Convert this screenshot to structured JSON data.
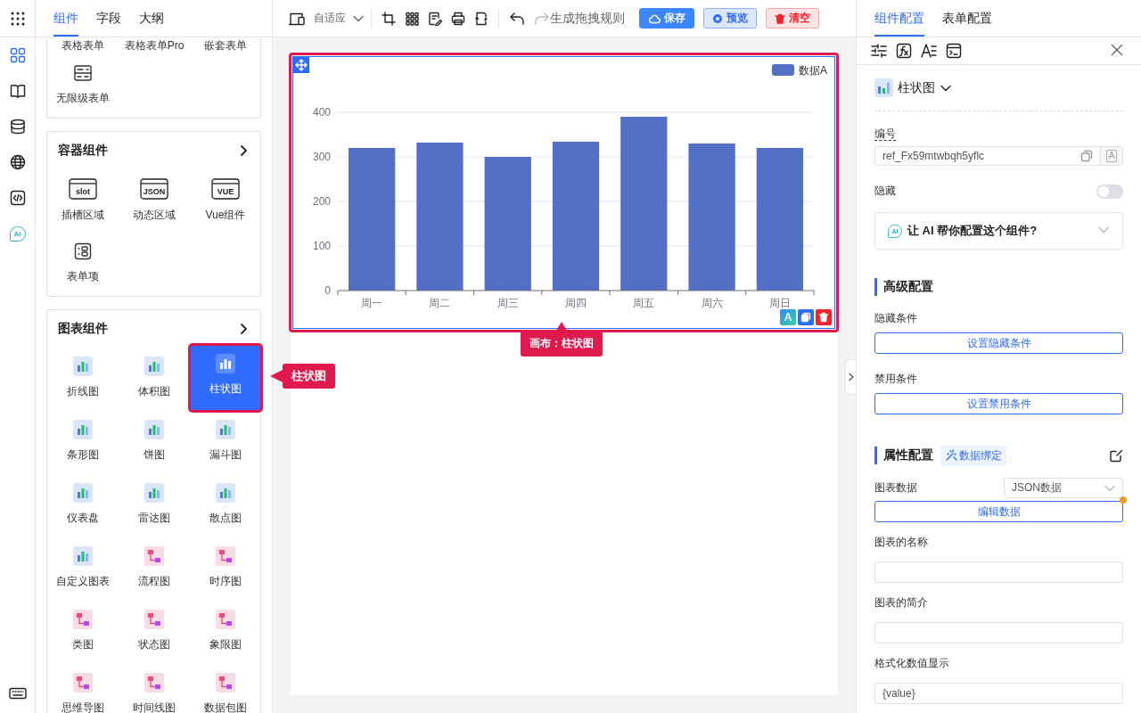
{
  "rail": {
    "items": [
      {
        "kind": "grid",
        "selected": true
      },
      {
        "kind": "book",
        "selected": false
      },
      {
        "kind": "database",
        "selected": false
      },
      {
        "kind": "globe",
        "selected": false
      },
      {
        "kind": "code",
        "selected": false
      },
      {
        "kind": "ai",
        "label": "AI",
        "selected": false
      }
    ]
  },
  "left_panel": {
    "tabs": [
      {
        "label": "组件",
        "selected": true
      },
      {
        "label": "字段",
        "selected": false
      },
      {
        "label": "大纲",
        "selected": false
      }
    ],
    "groups": [
      {
        "items": [
          {
            "label": "表格表单",
            "kind": "cut",
            "selected": false
          },
          {
            "label": "表格表单Pro",
            "kind": "cut",
            "selected": false
          },
          {
            "label": "嵌套表单",
            "kind": "cut",
            "selected": false
          },
          {
            "label": "无限级表单",
            "kind": "form",
            "selected": false
          }
        ]
      },
      {
        "title": "容器组件",
        "items": [
          {
            "label": "插槽区域",
            "kind": "container",
            "icon_text": "slot",
            "selected": false
          },
          {
            "label": "动态区域",
            "kind": "container",
            "icon_text": "JSON",
            "selected": false
          },
          {
            "label": "Vue组件",
            "kind": "container",
            "icon_text": "VUE",
            "selected": false
          },
          {
            "label": "表单项",
            "kind": "field",
            "selected": false
          }
        ]
      },
      {
        "title": "图表组件",
        "items": [
          {
            "label": "折线图",
            "kind": "chart",
            "selected": false
          },
          {
            "label": "体积图",
            "kind": "chart",
            "selected": false
          },
          {
            "label": "柱状图",
            "kind": "chart",
            "selected": true
          },
          {
            "label": "条形图",
            "kind": "chart",
            "selected": false
          },
          {
            "label": "饼图",
            "kind": "chart",
            "selected": false
          },
          {
            "label": "漏斗图",
            "kind": "chart",
            "selected": false
          },
          {
            "label": "仪表盘",
            "kind": "chart",
            "selected": false
          },
          {
            "label": "雷达图",
            "kind": "chart",
            "selected": false
          },
          {
            "label": "散点图",
            "kind": "chart",
            "selected": false
          },
          {
            "label": "自定义图表",
            "kind": "chart",
            "selected": false
          },
          {
            "label": "流程图",
            "kind": "diagram",
            "selected": false
          },
          {
            "label": "时序图",
            "kind": "diagram",
            "selected": false
          },
          {
            "label": "类图",
            "kind": "diagram",
            "selected": false
          },
          {
            "label": "状态图",
            "kind": "diagram",
            "selected": false
          },
          {
            "label": "象限图",
            "kind": "diagram",
            "selected": false
          },
          {
            "label": "思维导图",
            "kind": "diagram",
            "selected": false
          },
          {
            "label": "时间线图",
            "kind": "diagram",
            "selected": false
          },
          {
            "label": "数据包图",
            "kind": "diagram",
            "selected": false
          }
        ]
      }
    ],
    "callout": "柱状图"
  },
  "toolbar": {
    "layout_select": "自适应",
    "undo": {
      "disabled": false
    },
    "redo": {
      "disabled": true
    },
    "rule_link": "生成拖拽规则",
    "buttons": [
      {
        "label": "保存",
        "kind": "primary"
      },
      {
        "label": "预览",
        "kind": "secondary"
      },
      {
        "label": "清空",
        "kind": "danger"
      }
    ]
  },
  "canvas": {
    "widget": {
      "selected": true,
      "actions": [
        {
          "kind": "ai",
          "label": "A"
        },
        {
          "kind": "copy"
        },
        {
          "kind": "delete"
        }
      ],
      "chart_data": {
        "type": "bar",
        "categories": [
          "周一",
          "周二",
          "周三",
          "周四",
          "周五",
          "周六",
          "周日"
        ],
        "series": [
          {
            "name": "数据A",
            "color": "#5470c6",
            "values": [
              320,
              332,
              300,
              334,
              390,
              330,
              320
            ]
          }
        ],
        "ylim": [
          0,
          400
        ],
        "yticks": [
          0,
          100,
          200,
          300,
          400
        ],
        "grid": true
      }
    },
    "tooltip": "画布：柱状图"
  },
  "right_panel": {
    "tabs": [
      {
        "label": "组件配置",
        "selected": true
      },
      {
        "label": "表单配置",
        "selected": false
      }
    ],
    "component": "柱状图",
    "id_field": {
      "label": "编号",
      "value": "ref_Fx59mtwbqh5yflc",
      "badge": "A"
    },
    "hidden": {
      "label": "隐藏",
      "on": false
    },
    "ai_prompt": {
      "icon_text": "AI",
      "text": "让 AI 帮你配置这个组件?",
      "expanded": false
    },
    "advanced": {
      "title": "高级配置",
      "rows": [
        {
          "label": "隐藏条件",
          "button": "设置隐藏条件"
        },
        {
          "label": "禁用条件",
          "button": "设置禁用条件"
        }
      ]
    },
    "properties": {
      "title": "属性配置",
      "tag": "数据绑定",
      "select": {
        "label": "图表数据",
        "value": "JSON数据"
      },
      "edit_button": {
        "label": "编辑数据",
        "modified": true
      },
      "inputs": [
        {
          "label": "图表的名称"
        },
        {
          "label": "图表的简介"
        },
        {
          "label": "格式化数值显示",
          "value": "{value}"
        }
      ]
    }
  }
}
